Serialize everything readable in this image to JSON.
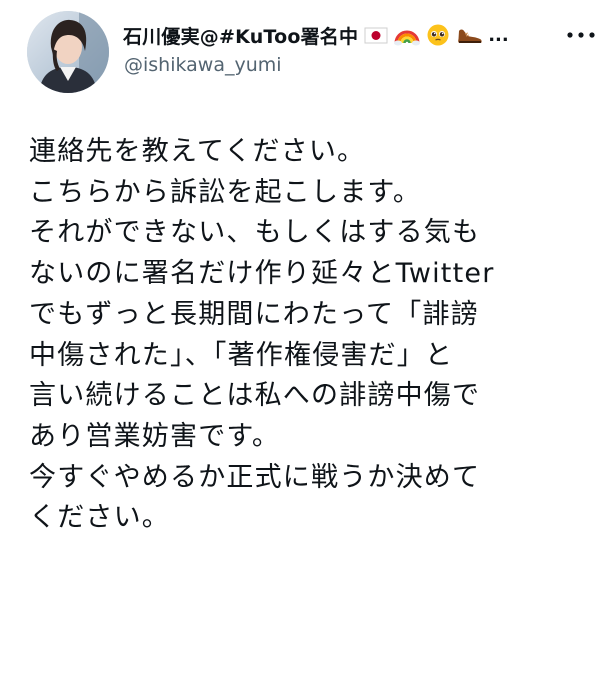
{
  "tweet": {
    "author": {
      "display_name": "石川優実@#KuToo署名中",
      "handle": "@ishikawa_yumi",
      "name_emojis": [
        "japan-flag-icon",
        "rainbow-icon",
        "pleading-face-icon",
        "shoe-icon"
      ],
      "name_truncation": "..."
    },
    "more_options_label": "•••",
    "text_lines": [
      "連絡先を教えてください。",
      "こちらから訴訟を起こします。",
      "それができない、もしくはする気も",
      "ないのに署名だけ作り延々とTwitter",
      "でもずっと長期間にわたって「誹謗",
      "中傷された」、「著作権侵害だ」と",
      "言い続けることは私への誹謗中傷で",
      "あり営業妨害です。",
      "今すぐやめるか正式に戦うか決めて",
      "ください。"
    ]
  },
  "colors": {
    "text_primary": "#0f1419",
    "text_secondary": "#536471",
    "background": "#ffffff"
  }
}
